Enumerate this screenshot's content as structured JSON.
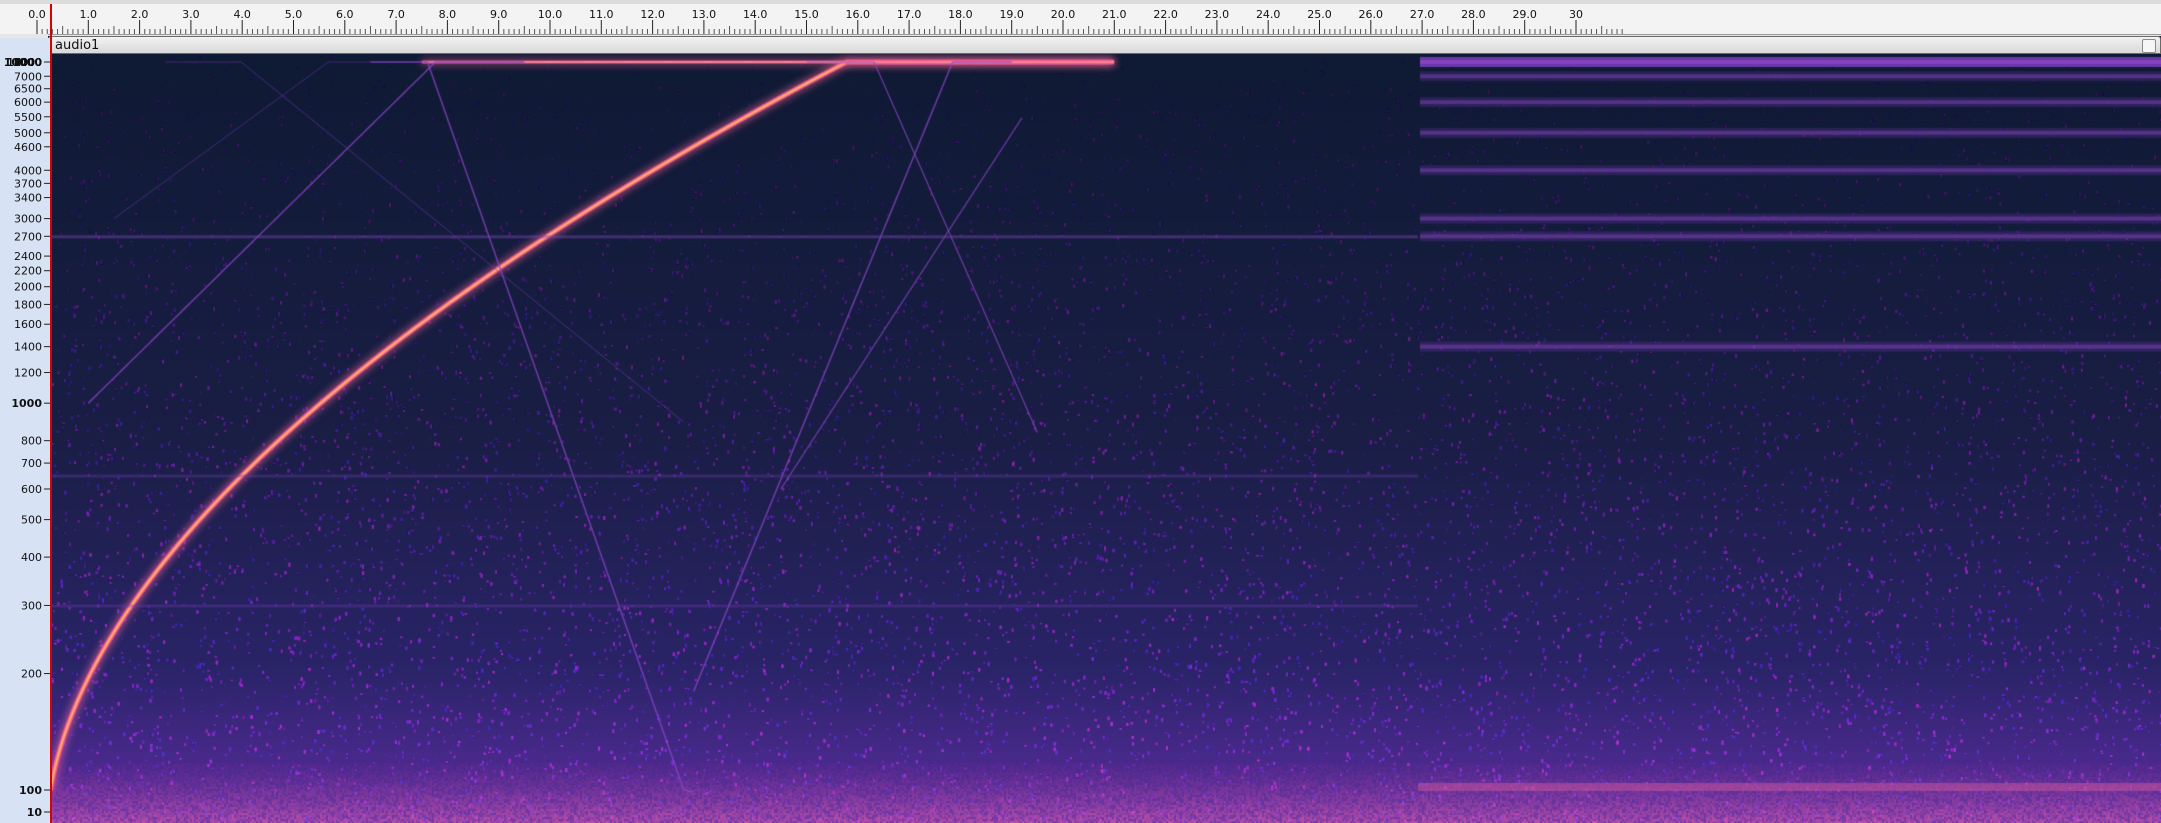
{
  "track": {
    "name": "audio1"
  },
  "timeline": {
    "labels": [
      "0.0",
      "1.0",
      "2.0",
      "3.0",
      "4.0",
      "5.0",
      "6.0",
      "7.0",
      "8.0",
      "9.0",
      "10.0",
      "11.0",
      "12.0",
      "13.0",
      "14.0",
      "15.0",
      "16.0",
      "17.0",
      "18.0",
      "19.0",
      "20.0",
      "21.0",
      "22.0",
      "23.0",
      "24.0",
      "25.0",
      "26.0",
      "27.0",
      "28.0",
      "29.0",
      "30"
    ]
  },
  "frequency_scale": {
    "labels": [
      {
        "text": "19000",
        "hz": 19000,
        "major": false
      },
      {
        "text": "17000",
        "hz": 17000,
        "major": false
      },
      {
        "text": "16000",
        "hz": 16000,
        "major": false
      },
      {
        "text": "15000",
        "hz": 15000,
        "major": false
      },
      {
        "text": "14000",
        "hz": 14000,
        "major": false
      },
      {
        "text": "13000",
        "hz": 13000,
        "major": false
      },
      {
        "text": "12000",
        "hz": 12000,
        "major": false
      },
      {
        "text": "11000",
        "hz": 11000,
        "major": false
      },
      {
        "text": "10000",
        "hz": 10000,
        "major": true
      },
      {
        "text": "9000",
        "hz": 9000,
        "major": false
      },
      {
        "text": "8000",
        "hz": 8000,
        "major": false
      },
      {
        "text": "7000",
        "hz": 7000,
        "major": false
      },
      {
        "text": "6500",
        "hz": 6500,
        "major": false
      },
      {
        "text": "6000",
        "hz": 6000,
        "major": false
      },
      {
        "text": "5500",
        "hz": 5500,
        "major": false
      },
      {
        "text": "5000",
        "hz": 5000,
        "major": false
      },
      {
        "text": "4600",
        "hz": 4600,
        "major": false
      },
      {
        "text": "4000",
        "hz": 4000,
        "major": false
      },
      {
        "text": "3700",
        "hz": 3700,
        "major": false
      },
      {
        "text": "3400",
        "hz": 3400,
        "major": false
      },
      {
        "text": "3000",
        "hz": 3000,
        "major": false
      },
      {
        "text": "2700",
        "hz": 2700,
        "major": false
      },
      {
        "text": "2400",
        "hz": 2400,
        "major": false
      },
      {
        "text": "2200",
        "hz": 2200,
        "major": false
      },
      {
        "text": "2000",
        "hz": 2000,
        "major": false
      },
      {
        "text": "1800",
        "hz": 1800,
        "major": false
      },
      {
        "text": "1600",
        "hz": 1600,
        "major": false
      },
      {
        "text": "1400",
        "hz": 1400,
        "major": false
      },
      {
        "text": "1200",
        "hz": 1200,
        "major": false
      },
      {
        "text": "1000",
        "hz": 1000,
        "major": true
      },
      {
        "text": "800",
        "hz": 800,
        "major": false
      },
      {
        "text": "700",
        "hz": 700,
        "major": false
      },
      {
        "text": "600",
        "hz": 600,
        "major": false
      },
      {
        "text": "500",
        "hz": 500,
        "major": false
      },
      {
        "text": "400",
        "hz": 400,
        "major": false
      },
      {
        "text": "300",
        "hz": 300,
        "major": false
      },
      {
        "text": "200",
        "hz": 200,
        "major": false
      },
      {
        "text": "100",
        "hz": 100,
        "major": true
      },
      {
        "text": "10",
        "hz": 10,
        "major": true
      }
    ]
  },
  "colors": {
    "background": "#1b1f3f",
    "noise_low": "#3a2b86",
    "noise_high": "#8a3bc0",
    "line_hot": "#ffb26b",
    "line_core": "#f0608a",
    "faint_line": "#7a3fb0",
    "ruler_bg": "#f3f3f3",
    "vscale_bg": "#d7e3f4",
    "cursor": "#d90000"
  }
}
